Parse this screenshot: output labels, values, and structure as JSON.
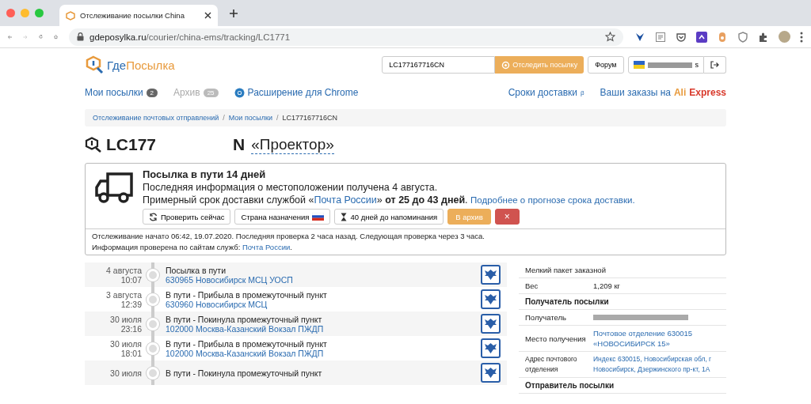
{
  "browser": {
    "tab_title": "Отслеживание посылки China",
    "url_host": "gdeposylka.ru",
    "url_path": "/courier/china-ems/tracking/LC1771"
  },
  "header": {
    "logo_part1": "Где",
    "logo_part2": "Посылка",
    "search_value": "LC177167716CN",
    "track_button": "Отследить посылку",
    "forum_button": "Форум",
    "user_suffix": "s"
  },
  "nav": {
    "left": [
      {
        "label": "Мои посылки",
        "count": "2",
        "active": true
      },
      {
        "label": "Архив",
        "count": "25",
        "active": false
      },
      {
        "label": "Расширение для Chrome",
        "active": true
      }
    ],
    "delivery_times": "Сроки доставки",
    "delivery_sup": "β",
    "orders_prefix": "Ваши заказы на",
    "ali_part1": "Ali",
    "ali_part2": "Express"
  },
  "breadcrumb_separator": "/",
  "breadcrumbs": [
    {
      "label": "Отслеживание почтовых отправлений",
      "link": true
    },
    {
      "label": "Мои посылки",
      "link": true
    },
    {
      "label": "LC177167716CN",
      "link": false
    }
  ],
  "parcel": {
    "number": "LC177",
    "name_prefix": "N",
    "name": "«Проектор»"
  },
  "status": {
    "title": "Посылка в пути 14 дней",
    "line1": "Последняя информация о местоположении получена 4 августа.",
    "line2_prefix": "Примерный срок доставки службой «",
    "service": "Почта России",
    "line2_mid": "»",
    "line2_bold": "от 25 до 43 дней",
    "line2_end": ".",
    "forecast_link": "Подробнее о прогнозе срока доставки.",
    "buttons": [
      {
        "kind": "refresh",
        "label": "Проверить сейчас"
      },
      {
        "kind": "country",
        "label": "Страна назначения"
      },
      {
        "kind": "timer",
        "label": "40 дней до напоминания"
      },
      {
        "kind": "archive",
        "label": "В архив"
      },
      {
        "kind": "delete",
        "label": "×"
      }
    ],
    "footer1": "Отслеживание начато 06:42, 19.07.2020. Последняя проверка 2 часа назад. Следующая проверка через 3 часа.",
    "footer2_prefix": "Информация проверена по сайтам служб:",
    "footer2_link": "Почта России",
    "footer2_end": "."
  },
  "events": [
    {
      "date": "4 августа",
      "time": "10:07",
      "title": "Посылка в пути",
      "place": "630965 Новосибирск МСЦ УОСП"
    },
    {
      "date": "3 августа",
      "time": "12:39",
      "title": "В пути - Прибыла в промежуточный пункт",
      "place": "630960 Новосибирск МСЦ"
    },
    {
      "date": "30 июля",
      "time": "23:16",
      "title": "В пути - Покинула промежуточный пункт",
      "place": "102000 Москва-Казанский Вокзал ПЖДП"
    },
    {
      "date": "30 июля",
      "time": "18:01",
      "title": "В пути - Прибыла в промежуточный пункт",
      "place": "102000 Москва-Казанский Вокзал ПЖДП"
    },
    {
      "date": "30 июля",
      "title": "В пути - Покинула промежуточный пункт"
    }
  ],
  "details": [
    {
      "kind": "note",
      "label": "Мелкий пакет заказной"
    },
    {
      "kind": "pair",
      "label": "Вес",
      "value": "1,209 кг",
      "link": false
    },
    {
      "kind": "heading",
      "label": "Получатель посылки"
    },
    {
      "kind": "redacted",
      "label": "Получатель"
    },
    {
      "kind": "pair",
      "label": "Место получения",
      "value": "Почтовое отделение 630015 «НОВОСИБИРСК 15»",
      "link": true
    },
    {
      "kind": "pair",
      "label": "Адрес почтового отделения",
      "value": "Индекс 630015, Новосибирская обл, г Новосибирск, Дзержинского пр-кт, 1А",
      "link": true,
      "small": true
    },
    {
      "kind": "heading",
      "label": "Отправитель посылки"
    }
  ]
}
